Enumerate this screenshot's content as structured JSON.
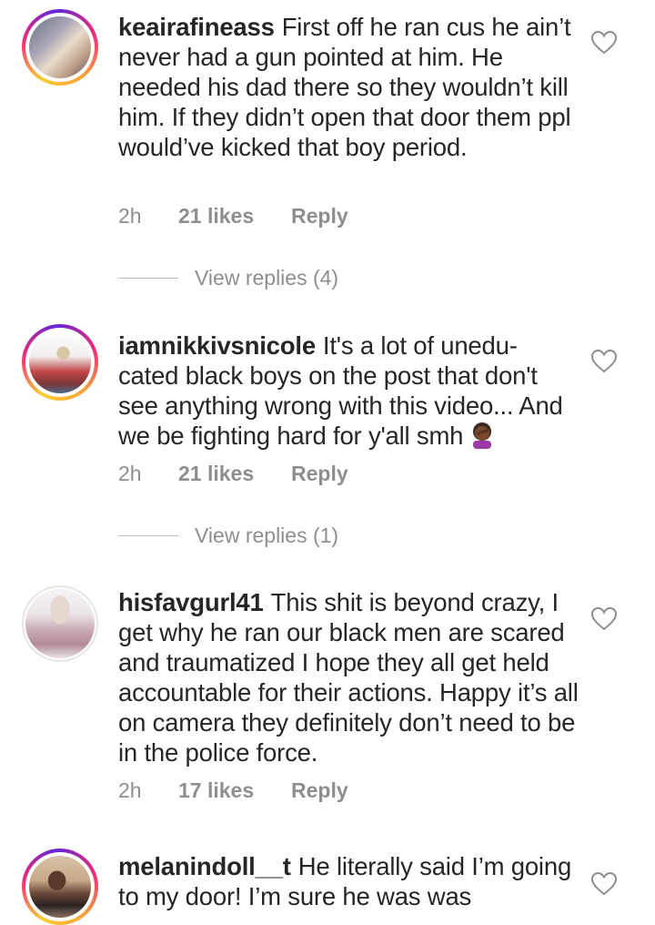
{
  "comments": [
    {
      "username": "keairafineass",
      "text": "First off he ran cus he ain’t never had a gun pointed at him.  He needed his dad there so they wouldn’t kill him.  If they didn’t open that door them ppl would’ve kicked that boy period.",
      "time": "2h",
      "likes": "21 likes",
      "reply": "Reply",
      "view_replies": "View replies (4)"
    },
    {
      "username": "iamnikkivsnicole",
      "text": "It's a lot of unedu- cated black boys on the post that don't see anything wrong with this video... And we be fighting hard for y'all smh",
      "time": "2h",
      "likes": "21 likes",
      "reply": "Reply",
      "view_replies": "View replies (1)"
    },
    {
      "username": "hisfavgurl41",
      "text": "This shit is beyond crazy, I get why he ran our black men are scared and traumatized I hope they all get held accountable for their actions. Happy it’s all on camera they definitely don’t need to be in the police force.",
      "time": "2h",
      "likes": "17 likes",
      "reply": "Reply"
    },
    {
      "username": "melanindoll__t",
      "text": "He literally said I’m going to my door! I’m sure he was was"
    }
  ],
  "icons": {
    "like": "heart-outline-icon",
    "facepalm": "woman-facepalming-emoji"
  },
  "colors": {
    "text": "#262626",
    "meta": "#8e8e8e",
    "ring_start": "#f9ce34",
    "ring_mid": "#ee2a7b",
    "ring_end": "#6228d7"
  }
}
